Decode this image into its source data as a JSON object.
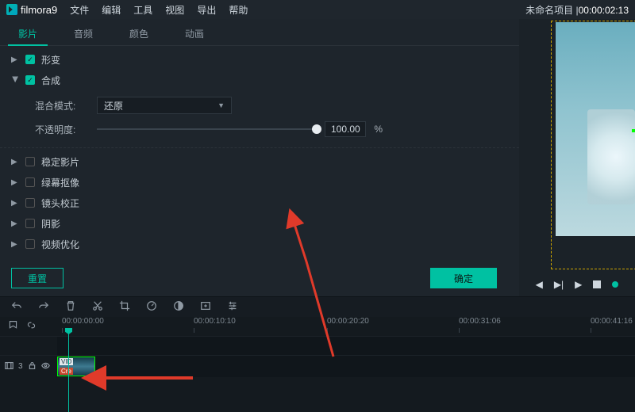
{
  "app": {
    "name": "filmora",
    "version": "9"
  },
  "menubar": {
    "items": [
      "文件",
      "编辑",
      "工具",
      "视图",
      "导出",
      "帮助"
    ]
  },
  "project": {
    "label_prefix": "未命名项目 |",
    "timecode": "00:00:02:13"
  },
  "property_tabs": [
    "影片",
    "音频",
    "颜色",
    "动画"
  ],
  "active_tab_index": 0,
  "sections": {
    "transform": {
      "label": "形变",
      "checked": true,
      "expanded": false
    },
    "composite": {
      "label": "合成",
      "checked": true,
      "expanded": true,
      "blend_label": "混合模式:",
      "blend_value": "还原",
      "opacity_label": "不透明度:",
      "opacity_value": "100.00",
      "opacity_unit": "%"
    },
    "stabilize": {
      "label": "稳定影片",
      "checked": false
    },
    "greenscreen": {
      "label": "绿幕抠像",
      "checked": false
    },
    "lens": {
      "label": "镜头校正",
      "checked": false
    },
    "shadow": {
      "label": "阴影",
      "checked": false
    },
    "optimize": {
      "label": "视频优化",
      "checked": false
    }
  },
  "buttons": {
    "reset": "重置",
    "ok": "确定"
  },
  "timeline": {
    "ticks": [
      "00:00:00:00",
      "00:00:10:10",
      "00:00:20:20",
      "00:00:31:06",
      "00:00:41:16"
    ],
    "track_label_prefix": "3",
    "clip_top_text": "VID",
    "clip_bottom_text": "Cre"
  },
  "icons": {
    "undo": "undo-icon",
    "redo": "redo-icon",
    "delete": "delete-icon",
    "cut": "cut-icon",
    "crop": "crop-icon",
    "speed": "speed-icon",
    "color": "color-icon",
    "export": "export-icon",
    "adjust": "adjust-icon",
    "marker": "marker-icon",
    "link": "link-icon",
    "film": "film-icon",
    "lock": "lock-icon",
    "eye": "eye-icon"
  }
}
